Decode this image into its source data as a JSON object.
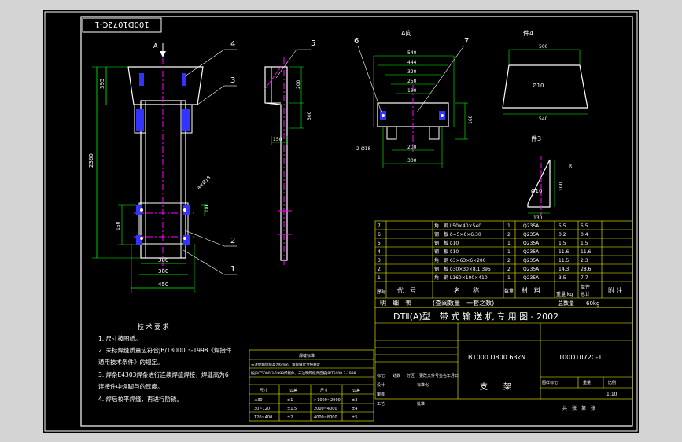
{
  "drawing_number": "100D1072C-1",
  "views": {
    "view_a_title": "A向",
    "part4_title": "件4",
    "part3_title": "件3",
    "arrow_label": "A"
  },
  "balloons": [
    "4",
    "3",
    "5",
    "6",
    "7",
    "2",
    "1"
  ],
  "dims": {
    "main_height": "2360",
    "main_top": "395",
    "main_bottom_width": "380",
    "main_bottom_width2": "450",
    "main_inner": "300",
    "main_small_1": "150",
    "main_small_2": "180",
    "main_small_3": "4×Ø18",
    "side_1": "200",
    "side_2": "300",
    "side_3": "150",
    "a_w1": "540",
    "a_w2": "444",
    "a_w3": "320",
    "a_w4": "250",
    "a_w5": "190",
    "a_w6": "200",
    "a_w7": "300",
    "a_hole": "2-Ø18",
    "a_h1": "160",
    "p4_top": "500",
    "p4_mid": "Ø10",
    "p4_bottom": "540",
    "p3_label": "Ø10",
    "p3_dim1": "100",
    "p3_dim2": "R",
    "p3_bottom": "130"
  },
  "tech_req": {
    "title": "技 术 要 求",
    "lines": [
      "1. 尺寸按图纸。",
      "2. 未标焊缝质量应符合JB/T3000.3-1998《焊接件",
      "   通用技术条件》的规定。",
      "3. 焊条E4303焊条进行连续焊缝焊接，焊缝高为6",
      "   连接件中焊脚与的厚度。",
      "4. 焊后校平焊缝，再进行防锈。"
    ]
  },
  "bom": {
    "rows": [
      {
        "seq": "7",
        "code": "",
        "name": "角　钢 L50×40×540",
        "qty": "1",
        "mat": "Q235A",
        "unit": "5.5",
        "total": "5.5"
      },
      {
        "seq": "6",
        "code": "",
        "name": "钢　板 δ=5×0×6.30",
        "qty": "2",
        "mat": "Q235A",
        "unit": "0.2",
        "total": "0.4"
      },
      {
        "seq": "5",
        "code": "",
        "name": "钢　板 δ10",
        "qty": "1",
        "mat": "Q235A",
        "unit": "1.5",
        "total": "1.5"
      },
      {
        "seq": "4",
        "code": "",
        "name": "钢　板 δ10",
        "qty": "1",
        "mat": "Q235A",
        "unit": "11.6",
        "total": "11.6"
      },
      {
        "seq": "3",
        "code": "",
        "name": "角　钢 63×63×6×200",
        "qty": "2",
        "mat": "Q235A",
        "unit": "11.5",
        "total": "2.3"
      },
      {
        "seq": "2",
        "code": "",
        "name": "钢　板 δ30×30×8.1.395",
        "qty": "2",
        "mat": "Q235A",
        "unit": "14.3",
        "total": "28.6"
      },
      {
        "seq": "1",
        "code": "",
        "name": "角　钢 L160×100×410",
        "qty": "1",
        "mat": "Q235A",
        "unit": "3.5",
        "total": "7.7"
      }
    ],
    "headers": {
      "seq": "序号",
      "code": "代　号",
      "name": "名　　称",
      "qty": "数量",
      "mat": "材　料",
      "unit": "单件",
      "total": "总计",
      "weight": "重量 kg",
      "note": "附 注"
    },
    "detail_label": "明　细　表",
    "detail_note": "(查阅数量　一套之数)",
    "total_weight_label": "总数量",
    "total_weight": "60kg"
  },
  "title_block": {
    "main_title": "DTⅡ(A)型　带 式 输 送 机 专 用 图 - 2002",
    "spec": "B1000.D800.63kN",
    "code": "100D1072C-1",
    "part_name": "支　　架",
    "scale_label": "比例",
    "scale": "1:10",
    "stage_label": "图样标记",
    "weight_label": "重量",
    "sheet_label": "共　张　第　张",
    "rows": [
      "标记",
      "处数",
      "分区",
      "更改文件号",
      "签名",
      "年月日",
      "设计",
      "标准化",
      "审核",
      "工艺",
      "批准"
    ]
  },
  "weld_table": {
    "title": "焊缝标准",
    "lines": [
      "未注明角焊缝高为6mm，角焊缝尺寸按规定",
      "按JB/T5000.3-1998焊接件，未注明焊缝高度按JB/T5000.3-1998"
    ],
    "headers": [
      "尺寸",
      "公差",
      "尺寸",
      "公差"
    ],
    "rows": [
      [
        "≤30",
        "±1",
        ">1000~2000",
        "±3"
      ],
      [
        "30~120",
        "±1.5",
        "2000~4000",
        "±4"
      ],
      [
        "120~400",
        "±2",
        "4000~8000",
        "±5"
      ],
      [
        "400~1000",
        "±2.5",
        "8000~12000",
        "±6"
      ]
    ]
  }
}
